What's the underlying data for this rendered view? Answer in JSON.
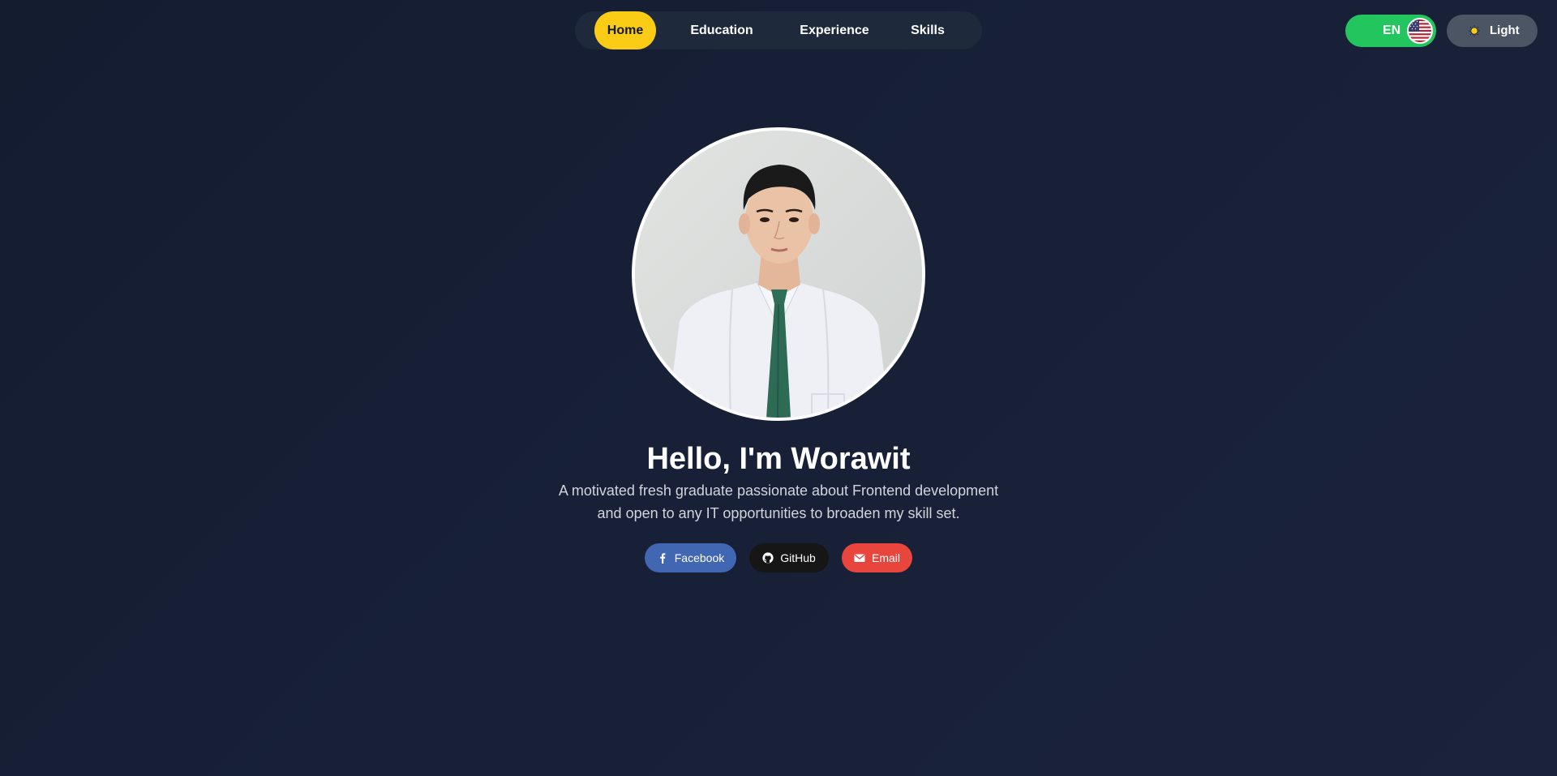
{
  "nav": {
    "items": [
      {
        "label": "Home",
        "active": true
      },
      {
        "label": "Education",
        "active": false
      },
      {
        "label": "Experience",
        "active": false
      },
      {
        "label": "Skills",
        "active": false
      }
    ]
  },
  "language": {
    "label": "EN",
    "flag": "us-flag-icon"
  },
  "theme": {
    "label": "Light",
    "icon": "sun-icon"
  },
  "hero": {
    "headline": "Hello, I'm Worawit",
    "bio_line1": "A motivated fresh graduate passionate about Frontend development",
    "bio_line2": "and open to any IT opportunities to broaden my skill set."
  },
  "social": {
    "facebook": "Facebook",
    "github": "GitHub",
    "email": "Email"
  },
  "colors": {
    "background": "#172037",
    "nav_bg": "#1e293b",
    "active_tab": "#facc15",
    "lang_toggle": "#22c55e",
    "theme_toggle": "#4b5563",
    "facebook": "#4267b2",
    "github": "#161616",
    "email": "#e8453c"
  }
}
